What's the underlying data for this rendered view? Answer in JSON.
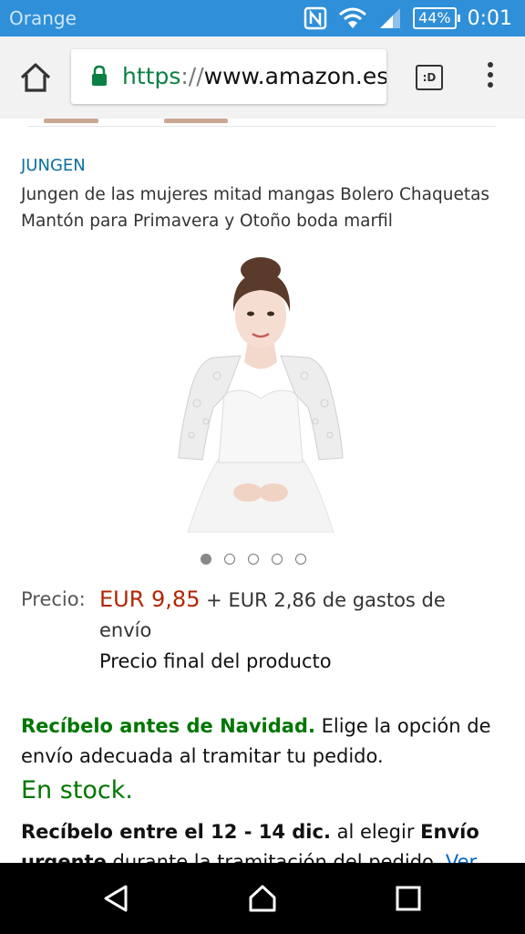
{
  "status": {
    "carrier": "Orange",
    "battery": "44%",
    "time": "0:01",
    "icons": [
      "nfc-icon",
      "wifi-icon",
      "signal-icon",
      "battery-icon"
    ]
  },
  "browser": {
    "url_scheme": "https",
    "url_sep": "://",
    "url_host": "www.amazon.es/",
    "tabs_label": ":D",
    "icons": [
      "home-icon",
      "lock-icon",
      "tabs-icon",
      "menu-icon"
    ]
  },
  "product": {
    "brand": "JUNGEN",
    "title": "Jungen de las mujeres mitad mangas Bolero Chaquetas Mantón para Primavera y Otoño boda marfil",
    "image_dots": 5,
    "image_active_index": 0
  },
  "pricing": {
    "label": "Precio:",
    "price": "EUR 9,85",
    "shipping": "+ EUR 2,86 de gastos de envío",
    "final_note": "Precio final del producto"
  },
  "delivery": {
    "highlight": "Recíbelo antes de Navidad.",
    "text": "Elige la opción de envío adecuada al tramitar tu pedido."
  },
  "availability": {
    "stock": "En stock.",
    "receive_bold": "Recíbelo entre el 12 - 14 dic.",
    "receive_mid": "al elegir",
    "receive_bold2": "Envío urgente",
    "receive_tail": "durante la tramitación del pedido.",
    "receive_link": "Ver"
  },
  "colors": {
    "statusbar": "#2f8fd8",
    "price": "#b12704",
    "green": "#007600",
    "link": "#0066c0"
  },
  "navigation": {
    "icons": [
      "back-icon",
      "home-nav-icon",
      "recents-icon"
    ]
  }
}
